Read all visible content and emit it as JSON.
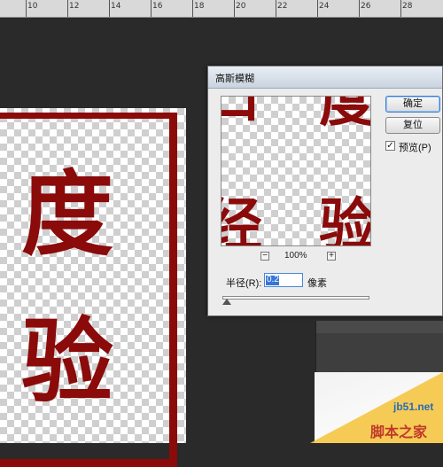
{
  "ruler": {
    "ticks": [
      "10",
      "12",
      "14",
      "16",
      "18",
      "20",
      "22",
      "24",
      "26",
      "28"
    ]
  },
  "canvas": {
    "chars": [
      "度",
      "验"
    ]
  },
  "dialog": {
    "title": "高斯模糊",
    "ok_label": "确定",
    "reset_label": "复位",
    "preview_label": "预览(P)",
    "preview_checked": true,
    "zoom_out": "−",
    "zoom_in": "+",
    "zoom_level": "100%",
    "radius_label": "半径(R):",
    "radius_value": "0.2",
    "unit_label": "像素",
    "preview_chars": [
      "口",
      "度",
      "经",
      "验"
    ]
  },
  "watermark": {
    "site": "jb51.net",
    "name": "脚本之家"
  },
  "colors": {
    "stamp": "#8b0a0a",
    "accent": "#3875d7"
  }
}
